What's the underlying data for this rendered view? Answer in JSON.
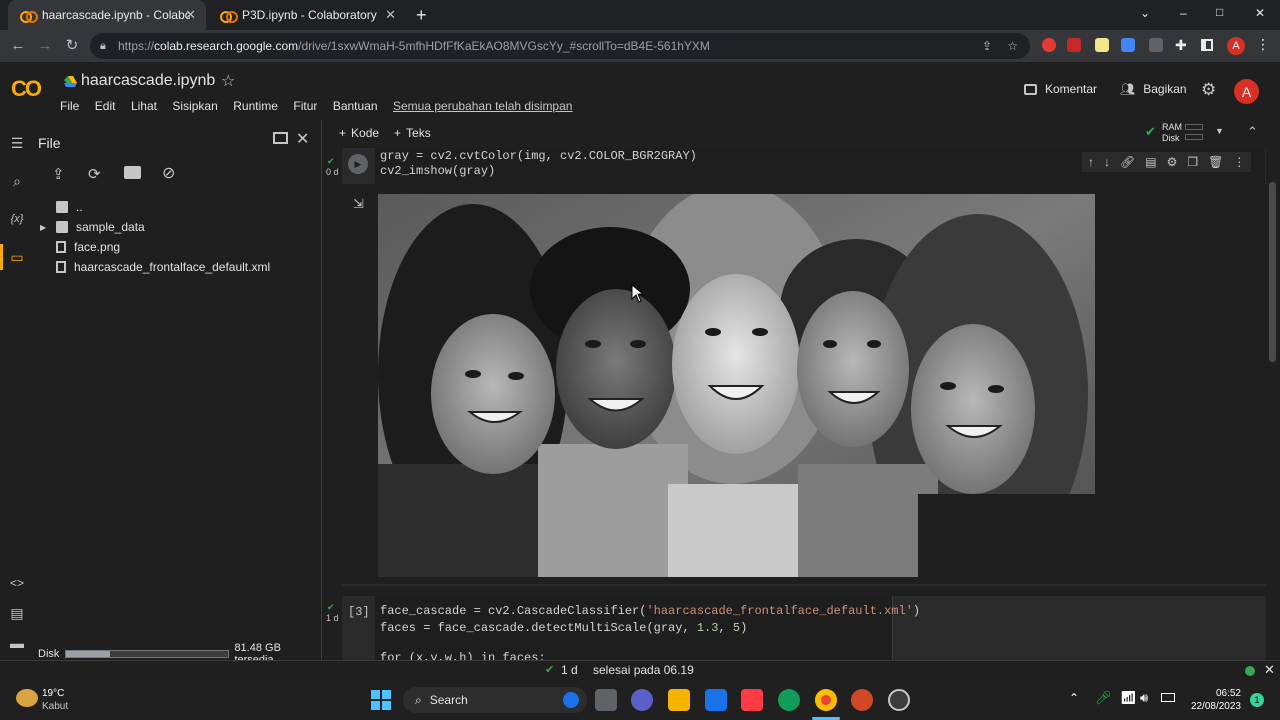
{
  "browser": {
    "tabs": [
      {
        "title": "haarcascade.ipynb - Colaboratory",
        "active": true
      },
      {
        "title": "P3D.ipynb - Colaboratory",
        "active": false
      }
    ],
    "new_tab": "+",
    "url_prefix": "https://",
    "url_host": "colab.research.google.com",
    "url_path": "/drive/1sxwWmaH-5mfhHDfFfKaEkAO8MVGscYy_#scrollTo=dB4E-561hYXM",
    "avatar_letter": "A",
    "window_controls": [
      "⌄",
      "–",
      "□",
      "✕"
    ]
  },
  "colab": {
    "logo": "CO",
    "notebook_name": "haarcascade.ipynb",
    "menus": [
      "File",
      "Edit",
      "Lihat",
      "Sisipkan",
      "Runtime",
      "Fitur",
      "Bantuan"
    ],
    "save_status": "Semua perubahan telah disimpan",
    "comment_label": "Komentar",
    "share_label": "Bagikan",
    "avatar_letter": "A"
  },
  "sidebar": {
    "title": "File",
    "tree": [
      {
        "name": "..",
        "type": "up"
      },
      {
        "name": "sample_data",
        "type": "folder"
      },
      {
        "name": "face.png",
        "type": "file"
      },
      {
        "name": "haarcascade_frontalface_default.xml",
        "type": "file"
      }
    ],
    "disk_label": "Disk",
    "disk_fill": 0.27,
    "disk_free": "81.48 GB tersedia"
  },
  "toolbar": {
    "add_code": "Kode",
    "add_text": "Teks",
    "ram_label": "RAM",
    "disk_label": "Disk"
  },
  "cell1": {
    "exec_time": "0 d",
    "lines": [
      "gray = cv2.cvtColor(img, cv2.COLOR_BGR2GRAY)",
      "cv2_imshow(gray)"
    ]
  },
  "cell2": {
    "exec_count": "[3]",
    "exec_time": "1 d",
    "line1_a": "face_cascade = cv2.CascadeClassifier(",
    "line1_str": "'haarcascade_frontalface_default.xml'",
    "line1_b": ")",
    "line2_a": "faces = face_cascade.detectMultiScale(gray, ",
    "line2_n1": "1.3",
    "line2_sep": ", ",
    "line2_n2": "5",
    "line2_b": ")",
    "line3": "for (x,y,w,h) in faces:"
  },
  "status": {
    "duration": "1 d",
    "message": "selesai pada 06.19"
  },
  "taskbar": {
    "weather_temp": "19°C",
    "weather_desc": "Kabut",
    "search_label": "Search",
    "time": "06:52",
    "date": "22/08/2023",
    "notif_count": "1"
  },
  "colors": {
    "accent_orange": "#f9ab00",
    "link_blue": "#8ab4f8",
    "avatar_red": "#d93025",
    "success_green": "#34a853"
  }
}
